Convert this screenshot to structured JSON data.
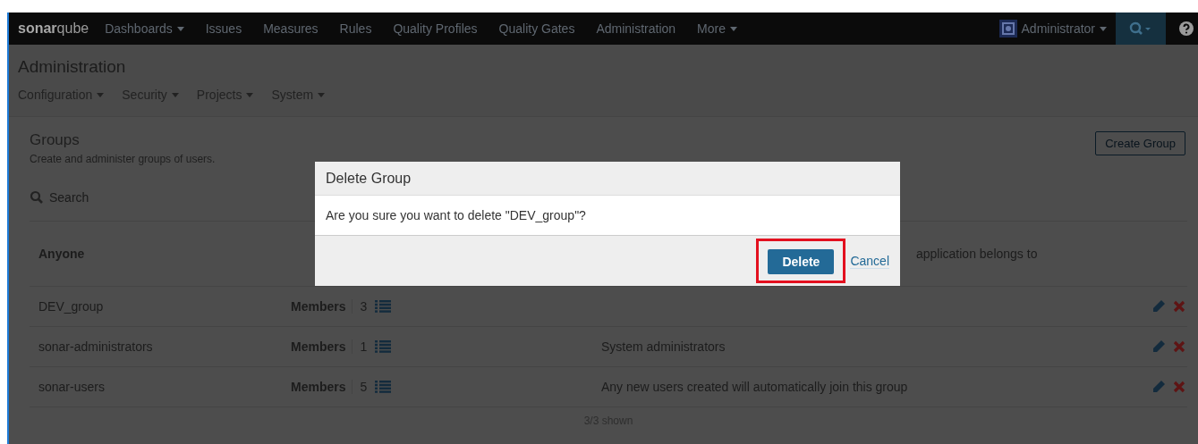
{
  "navbar": {
    "logo": {
      "bold": "sonar",
      "light": "qube"
    },
    "items": [
      {
        "label": "Dashboards",
        "dropdown": true
      },
      {
        "label": "Issues",
        "dropdown": false
      },
      {
        "label": "Measures",
        "dropdown": false
      },
      {
        "label": "Rules",
        "dropdown": false
      },
      {
        "label": "Quality Profiles",
        "dropdown": false
      },
      {
        "label": "Quality Gates",
        "dropdown": false
      },
      {
        "label": "Administration",
        "dropdown": false
      },
      {
        "label": "More",
        "dropdown": true
      }
    ],
    "user": "Administrator"
  },
  "page": {
    "title": "Administration",
    "menu": [
      {
        "label": "Configuration"
      },
      {
        "label": "Security"
      },
      {
        "label": "Projects"
      },
      {
        "label": "System"
      }
    ]
  },
  "groups": {
    "title": "Groups",
    "subtitle": "Create and administer groups of users.",
    "create_button": "Create Group",
    "search": {
      "placeholder": "Search"
    },
    "rows": [
      {
        "name": "Anyone",
        "members_label": null,
        "members_count": null,
        "description": "application belongs to",
        "editable": false
      },
      {
        "name": "DEV_group",
        "members_label": "Members",
        "members_count": "3",
        "description": null,
        "editable": true
      },
      {
        "name": "sonar-administrators",
        "members_label": "Members",
        "members_count": "1",
        "description": "System administrators",
        "editable": true
      },
      {
        "name": "sonar-users",
        "members_label": "Members",
        "members_count": "5",
        "description": "Any new users created will automatically join this group",
        "editable": true
      }
    ],
    "footer": "3/3 shown"
  },
  "dialog": {
    "title": "Delete Group",
    "message": "Are you sure you want to delete \"DEV_group\"?",
    "confirm": "Delete",
    "cancel": "Cancel",
    "confirm_highlighted": true
  }
}
